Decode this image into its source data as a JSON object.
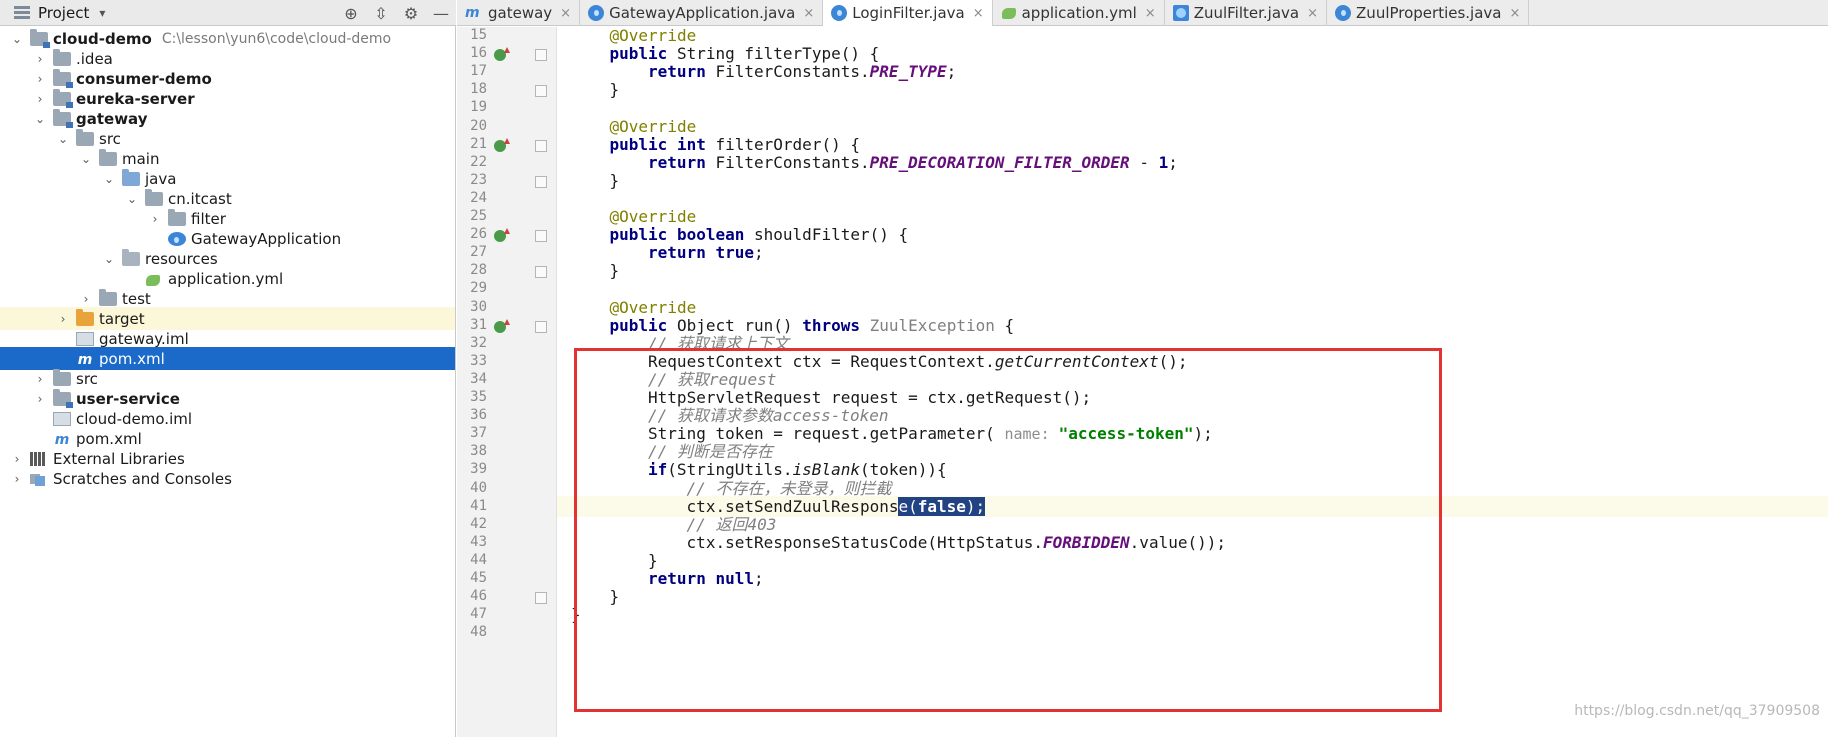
{
  "project_panel": {
    "title": "Project",
    "tree": [
      {
        "depth": 0,
        "arrow": "⌄",
        "icon": "module-folder",
        "label": "cloud-demo",
        "bold": true,
        "path": "C:\\lesson\\yun6\\code\\cloud-demo"
      },
      {
        "depth": 1,
        "arrow": "›",
        "icon": "folder",
        "label": ".idea"
      },
      {
        "depth": 1,
        "arrow": "›",
        "icon": "module-folder",
        "label": "consumer-demo",
        "bold": true
      },
      {
        "depth": 1,
        "arrow": "›",
        "icon": "module-folder",
        "label": "eureka-server",
        "bold": true
      },
      {
        "depth": 1,
        "arrow": "⌄",
        "icon": "module-folder",
        "label": "gateway",
        "bold": true
      },
      {
        "depth": 2,
        "arrow": "⌄",
        "icon": "folder",
        "label": "src"
      },
      {
        "depth": 3,
        "arrow": "⌄",
        "icon": "folder",
        "label": "main"
      },
      {
        "depth": 4,
        "arrow": "⌄",
        "icon": "src-folder",
        "label": "java"
      },
      {
        "depth": 5,
        "arrow": "⌄",
        "icon": "package",
        "label": "cn.itcast"
      },
      {
        "depth": 6,
        "arrow": "›",
        "icon": "package",
        "label": "filter"
      },
      {
        "depth": 6,
        "arrow": "",
        "icon": "class",
        "label": "GatewayApplication"
      },
      {
        "depth": 4,
        "arrow": "⌄",
        "icon": "resources-folder",
        "label": "resources"
      },
      {
        "depth": 5,
        "arrow": "",
        "icon": "yml",
        "label": "application.yml"
      },
      {
        "depth": 3,
        "arrow": "›",
        "icon": "folder",
        "label": "test"
      },
      {
        "depth": 2,
        "arrow": "›",
        "icon": "target-folder",
        "label": "target",
        "highlight": true
      },
      {
        "depth": 2,
        "arrow": "",
        "icon": "iml",
        "label": "gateway.iml"
      },
      {
        "depth": 2,
        "arrow": "",
        "icon": "maven",
        "label": "pom.xml",
        "selected": true
      },
      {
        "depth": 1,
        "arrow": "›",
        "icon": "folder",
        "label": "src"
      },
      {
        "depth": 1,
        "arrow": "›",
        "icon": "module-folder",
        "label": "user-service",
        "bold": true
      },
      {
        "depth": 1,
        "arrow": "",
        "icon": "iml",
        "label": "cloud-demo.iml"
      },
      {
        "depth": 1,
        "arrow": "",
        "icon": "maven",
        "label": "pom.xml"
      },
      {
        "depth": 0,
        "arrow": "›",
        "icon": "libraries",
        "label": "External Libraries"
      },
      {
        "depth": 0,
        "arrow": "›",
        "icon": "scratches",
        "label": "Scratches and Consoles"
      }
    ]
  },
  "tabs": [
    {
      "icon": "m",
      "label": "gateway",
      "active": false
    },
    {
      "icon": "c",
      "label": "GatewayApplication.java",
      "active": false
    },
    {
      "icon": "c",
      "label": "LoginFilter.java",
      "active": true
    },
    {
      "icon": "y",
      "label": "application.yml",
      "active": false
    },
    {
      "icon": "i",
      "label": "ZuulFilter.java",
      "active": false
    },
    {
      "icon": "c",
      "label": "ZuulProperties.java",
      "active": false
    }
  ],
  "editor": {
    "lines": [
      {
        "n": "15",
        "indent": 4,
        "tokens": [
          [
            "an",
            "@Override"
          ]
        ]
      },
      {
        "n": "16",
        "indent": 4,
        "override": true,
        "fold": true,
        "tokens": [
          [
            "kw",
            "public "
          ],
          [
            "",
            "String filterType() {"
          ]
        ]
      },
      {
        "n": "17",
        "indent": 8,
        "tokens": [
          [
            "kw",
            "return "
          ],
          [
            "",
            "FilterConstants."
          ],
          [
            "it",
            "PRE_TYPE"
          ],
          [
            "",
            ";"
          ]
        ]
      },
      {
        "n": "18",
        "indent": 4,
        "fold": true,
        "tokens": [
          [
            "",
            "}"
          ]
        ]
      },
      {
        "n": "19",
        "indent": 0,
        "tokens": []
      },
      {
        "n": "20",
        "indent": 4,
        "tokens": [
          [
            "an",
            "@Override"
          ]
        ]
      },
      {
        "n": "21",
        "indent": 4,
        "override": true,
        "fold": true,
        "tokens": [
          [
            "kw",
            "public int "
          ],
          [
            "",
            "filterOrder() {"
          ]
        ]
      },
      {
        "n": "22",
        "indent": 8,
        "tokens": [
          [
            "kw",
            "return "
          ],
          [
            "",
            "FilterConstants."
          ],
          [
            "it",
            "PRE_DECORATION_FILTER_ORDER"
          ],
          [
            "",
            " - "
          ],
          [
            "kw",
            "1"
          ],
          [
            "",
            ";"
          ]
        ]
      },
      {
        "n": "23",
        "indent": 4,
        "fold": true,
        "tokens": [
          [
            "",
            "}"
          ]
        ]
      },
      {
        "n": "24",
        "indent": 0,
        "tokens": []
      },
      {
        "n": "25",
        "indent": 4,
        "tokens": [
          [
            "an",
            "@Override"
          ]
        ]
      },
      {
        "n": "26",
        "indent": 4,
        "override": true,
        "fold": true,
        "tokens": [
          [
            "kw",
            "public boolean "
          ],
          [
            "",
            "shouldFilter() {"
          ]
        ]
      },
      {
        "n": "27",
        "indent": 8,
        "tokens": [
          [
            "kw",
            "return true"
          ],
          [
            "",
            ";"
          ]
        ]
      },
      {
        "n": "28",
        "indent": 4,
        "fold": true,
        "tokens": [
          [
            "",
            "}"
          ]
        ]
      },
      {
        "n": "29",
        "indent": 0,
        "tokens": []
      },
      {
        "n": "30",
        "indent": 4,
        "tokens": [
          [
            "an",
            "@Override"
          ]
        ]
      },
      {
        "n": "31",
        "indent": 4,
        "override": true,
        "fold": true,
        "tokens": [
          [
            "kw",
            "public "
          ],
          [
            "",
            "Object run() "
          ],
          [
            "kw",
            "throws "
          ],
          [
            "gr",
            "ZuulException "
          ],
          [
            "",
            "{"
          ]
        ]
      },
      {
        "n": "32",
        "indent": 8,
        "tokens": [
          [
            "cm",
            "// 获取请求上下文"
          ]
        ]
      },
      {
        "n": "33",
        "indent": 8,
        "tokens": [
          [
            "",
            "RequestContext ctx = RequestContext."
          ],
          [
            "sm",
            "getCurrentContext"
          ],
          [
            "",
            "();"
          ]
        ]
      },
      {
        "n": "34",
        "indent": 8,
        "tokens": [
          [
            "cm",
            "// 获取request"
          ]
        ]
      },
      {
        "n": "35",
        "indent": 8,
        "tokens": [
          [
            "",
            "HttpServletRequest request = ctx.getRequest();"
          ]
        ]
      },
      {
        "n": "36",
        "indent": 8,
        "tokens": [
          [
            "cm",
            "// 获取请求参数access-token"
          ]
        ]
      },
      {
        "n": "37",
        "indent": 8,
        "tokens": [
          [
            "",
            "String token = request.getParameter( "
          ],
          [
            "hint",
            "name: "
          ],
          [
            "st",
            "\"access-token\""
          ],
          [
            "",
            ");"
          ]
        ]
      },
      {
        "n": "38",
        "indent": 8,
        "tokens": [
          [
            "cm",
            "// 判断是否存在"
          ]
        ]
      },
      {
        "n": "39",
        "indent": 8,
        "tokens": [
          [
            "kw",
            "if"
          ],
          [
            "",
            "(StringUtils."
          ],
          [
            "sm",
            "isBlank"
          ],
          [
            "",
            "(token)){"
          ]
        ]
      },
      {
        "n": "40",
        "indent": 12,
        "tokens": [
          [
            "cm",
            "// 不存在，未登录，则拦截"
          ]
        ]
      },
      {
        "n": "41",
        "indent": 12,
        "caret": true,
        "tokens": [
          [
            "",
            "ctx.setSendZuulRespons"
          ],
          [
            "sel",
            "e("
          ],
          [
            "sel-kw",
            "false"
          ],
          [
            "sel",
            ");"
          ]
        ]
      },
      {
        "n": "42",
        "indent": 12,
        "tokens": [
          [
            "cm",
            "// 返回403"
          ]
        ]
      },
      {
        "n": "43",
        "indent": 12,
        "tokens": [
          [
            "",
            "ctx.setResponseStatusCode(HttpStatus."
          ],
          [
            "it",
            "FORBIDDEN"
          ],
          [
            "",
            ".value());"
          ]
        ]
      },
      {
        "n": "44",
        "indent": 8,
        "tokens": [
          [
            "",
            "}"
          ]
        ]
      },
      {
        "n": "45",
        "indent": 8,
        "tokens": [
          [
            "kw",
            "return null"
          ],
          [
            "",
            ";"
          ]
        ]
      },
      {
        "n": "46",
        "indent": 4,
        "fold": true,
        "tokens": [
          [
            "",
            "}"
          ]
        ]
      },
      {
        "n": "47",
        "indent": 0,
        "tokens": [
          [
            "",
            "}"
          ]
        ]
      },
      {
        "n": "48",
        "indent": 0,
        "tokens": []
      }
    ]
  },
  "watermark": "https://blog.csdn.net/qq_37909508",
  "colors": {
    "selection": "#1b6ac9",
    "annotation_box": "#e23232",
    "keyword": "#000080"
  }
}
